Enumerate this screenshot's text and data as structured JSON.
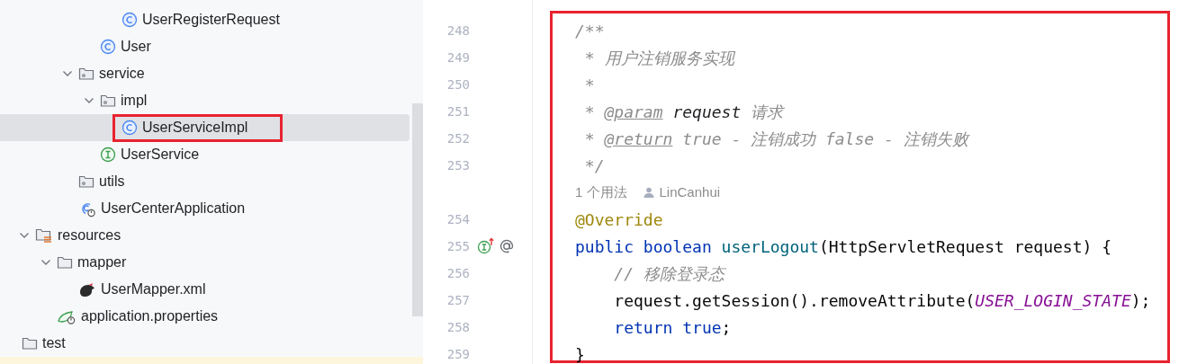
{
  "project_tree": [
    {
      "children": [
        {
          "children": [
            {
              "children": [
                {
                  "children": [
                    {
                      "children": [
                        {
                          "label": "UserRegisterRequest",
                          "kind": "class",
                          "selected": false
                        }
                      ]
                    },
                    {
                      "label": "User",
                      "kind": "class",
                      "selected": false
                    }
                  ]
                },
                {
                  "label": "service",
                  "kind": "package",
                  "expanded": true,
                  "selected": false,
                  "children": [
                    {
                      "label": "impl",
                      "kind": "package",
                      "expanded": true,
                      "selected": false,
                      "children": [
                        {
                          "label": "UserServiceImpl",
                          "kind": "class",
                          "selected": true
                        }
                      ]
                    },
                    {
                      "label": "UserService",
                      "kind": "interface",
                      "selected": false
                    }
                  ]
                },
                {
                  "label": "utils",
                  "kind": "package",
                  "selected": false
                },
                {
                  "label": "UserCenterApplication",
                  "kind": "app",
                  "selected": false
                }
              ]
            }
          ]
        },
        {
          "label": "resources",
          "kind": "resources",
          "expanded": true,
          "selected": false,
          "children": [
            {
              "label": "mapper",
              "kind": "folder",
              "expanded": true,
              "selected": false,
              "children": [
                {
                  "label": "UserMapper.xml",
                  "kind": "xml",
                  "selected": false
                }
              ]
            },
            {
              "label": "application.properties",
              "kind": "properties",
              "selected": false
            }
          ]
        }
      ]
    },
    {
      "label": "test",
      "kind": "folder",
      "selected": false
    }
  ],
  "editor": {
    "lines": [
      {
        "number": "248",
        "tokens": [
          {
            "text": "/**",
            "kind": "comment"
          }
        ]
      },
      {
        "number": "249",
        "tokens": [
          {
            "text": " * 用户注销服务实现",
            "kind": "comment"
          }
        ]
      },
      {
        "number": "250",
        "tokens": [
          {
            "text": " *",
            "kind": "comment"
          }
        ]
      },
      {
        "number": "251",
        "tokens": [
          {
            "text": " * ",
            "kind": "comment"
          },
          {
            "text": "@param",
            "kind": "doc-tag"
          },
          {
            "text": " request",
            "kind": "doc-param"
          },
          {
            "text": " 请求",
            "kind": "comment"
          }
        ]
      },
      {
        "number": "252",
        "tokens": [
          {
            "text": " * ",
            "kind": "comment"
          },
          {
            "text": "@return",
            "kind": "doc-tag"
          },
          {
            "text": " true - 注销成功 false - 注销失败",
            "kind": "comment"
          }
        ]
      },
      {
        "number": "253",
        "tokens": [
          {
            "text": " */",
            "kind": "comment"
          }
        ]
      },
      {
        "kind": "hint",
        "usages": "1 个用法",
        "author": "LinCanhui"
      },
      {
        "number": "254",
        "tokens": [
          {
            "text": "@Override",
            "kind": "annotation"
          }
        ]
      },
      {
        "number": "255",
        "implements_marker": true,
        "tokens": [
          {
            "text": "public boolean ",
            "kind": "keyword"
          },
          {
            "text": "userLogout",
            "kind": "function"
          },
          {
            "text": "(HttpServletRequest request) {",
            "kind": "plain"
          }
        ]
      },
      {
        "number": "256",
        "tokens": [
          {
            "text": "    // 移除登录态",
            "kind": "comment"
          }
        ]
      },
      {
        "number": "257",
        "tokens": [
          {
            "text": "    request.getSession().removeAttribute(",
            "kind": "plain"
          },
          {
            "text": "USER_LOGIN_STATE",
            "kind": "constant"
          },
          {
            "text": ");",
            "kind": "plain"
          }
        ]
      },
      {
        "number": "258",
        "tokens": [
          {
            "text": "    return true",
            "kind": "keyword"
          },
          {
            "text": ";",
            "kind": "plain"
          }
        ]
      },
      {
        "number": "259",
        "tokens": [
          {
            "text": "}",
            "kind": "plain"
          }
        ]
      }
    ]
  }
}
